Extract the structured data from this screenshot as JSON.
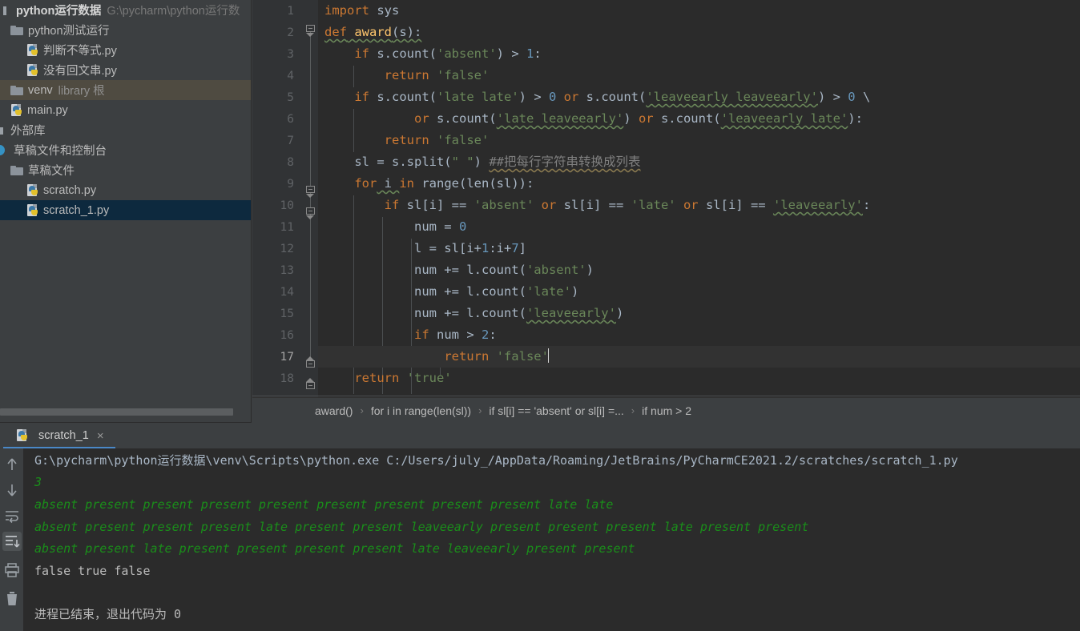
{
  "project": {
    "title": "python运行数据",
    "path": "G:\\pycharm\\python运行数",
    "items": [
      {
        "label": "python运行数据",
        "suffix": "G:\\pycharm\\python运行数",
        "icon": "module-icon",
        "indent": 0,
        "bold": true,
        "selected": false
      },
      {
        "label": "python测试运行",
        "suffix": "",
        "icon": "folder-icon",
        "indent": 1,
        "bold": false,
        "selected": false
      },
      {
        "label": "判断不等式.py",
        "suffix": "",
        "icon": "python-file-icon",
        "indent": 2,
        "bold": false,
        "selected": false
      },
      {
        "label": "没有回文串.py",
        "suffix": "",
        "icon": "python-file-icon",
        "indent": 2,
        "bold": false,
        "selected": false
      },
      {
        "label": "venv",
        "suffix": "library 根",
        "icon": "folder-icon",
        "indent": 1,
        "bold": false,
        "selected": false,
        "highlight": true
      },
      {
        "label": "main.py",
        "suffix": "",
        "icon": "python-file-icon",
        "indent": 1,
        "bold": false,
        "selected": false
      },
      {
        "label": "外部库",
        "suffix": "",
        "icon": "external-libraries-icon",
        "indent": 0,
        "bold": false,
        "selected": false
      },
      {
        "label": "草稿文件和控制台",
        "suffix": "",
        "icon": "scratches-icon",
        "indent": 0,
        "bold": false,
        "selected": false
      },
      {
        "label": "草稿文件",
        "suffix": "",
        "icon": "folder-icon",
        "indent": 1,
        "bold": false,
        "selected": false
      },
      {
        "label": "scratch.py",
        "suffix": "",
        "icon": "python-file-icon",
        "indent": 2,
        "bold": false,
        "selected": false
      },
      {
        "label": "scratch_1.py",
        "suffix": "",
        "icon": "python-file-icon",
        "indent": 2,
        "bold": false,
        "selected": true
      }
    ]
  },
  "editor": {
    "lines": [
      {
        "n": "1",
        "current": false
      },
      {
        "n": "2",
        "current": false
      },
      {
        "n": "3",
        "current": false
      },
      {
        "n": "4",
        "current": false
      },
      {
        "n": "5",
        "current": false
      },
      {
        "n": "6",
        "current": false
      },
      {
        "n": "7",
        "current": false
      },
      {
        "n": "8",
        "current": false
      },
      {
        "n": "9",
        "current": false
      },
      {
        "n": "10",
        "current": false
      },
      {
        "n": "11",
        "current": false
      },
      {
        "n": "12",
        "current": false
      },
      {
        "n": "13",
        "current": false
      },
      {
        "n": "14",
        "current": false
      },
      {
        "n": "15",
        "current": false
      },
      {
        "n": "16",
        "current": false
      },
      {
        "n": "17",
        "current": true
      },
      {
        "n": "18",
        "current": false
      }
    ],
    "code": {
      "l1_import": "import",
      "l1_sys": " sys",
      "l2_def": "def",
      "l2_name": " award",
      "l2_rest": "(s):",
      "l3_a": "    ",
      "l3_if": "if",
      "l3_b": " s.count(",
      "l3_str": "'absent'",
      "l3_c": ") > ",
      "l3_num": "1",
      "l3_d": ":",
      "l4_a": "        ",
      "l4_ret": "return",
      "l4_str": " 'false'",
      "l5_a": "    ",
      "l5_if": "if",
      "l5_b": " s.count(",
      "l5_s1": "'late late'",
      "l5_c": ") > ",
      "l5_n": "0",
      "l5_or": " or",
      "l5_d": " s.count(",
      "l5_s2": "'leaveearly leaveearly'",
      "l5_e": ") > ",
      "l5_n2": "0",
      "l5_f": " \\",
      "l6_a": "            ",
      "l6_or": "or",
      "l6_b": " s.count(",
      "l6_s1": "'late leaveearly'",
      "l6_c": ")",
      "l6_or2": " or",
      "l6_d": " s.count(",
      "l6_s2": "'leaveearly late'",
      "l6_e": "):",
      "l7_a": "        ",
      "l7_ret": "return",
      "l7_str": " 'false'",
      "l8_a": "    sl = s.split(",
      "l8_str": "\" \"",
      "l8_b": ") ",
      "l8_cmt": "##把每行字符串转换成列表",
      "l9_a": "    ",
      "l9_for": "for",
      "l9_i": " i ",
      "l9_in": "in",
      "l9_rest": " range(len(sl)):",
      "l10_a": "        ",
      "l10_if": "if",
      "l10_b": " sl[i] == ",
      "l10_s1": "'absent'",
      "l10_or": " or",
      "l10_c": " sl[i] == ",
      "l10_s2": "'late'",
      "l10_or2": " or",
      "l10_d": " sl[i] == ",
      "l10_s3": "'leaveearly'",
      "l10_e": ":",
      "l11_a": "            num = ",
      "l11_n": "0",
      "l12_a": "            l = sl[i+",
      "l12_n1": "1",
      "l12_b": ":i+",
      "l12_n2": "7",
      "l12_c": "]",
      "l13_a": "            num += l.count(",
      "l13_s": "'absent'",
      "l13_b": ")",
      "l14_a": "            num += l.count(",
      "l14_s": "'late'",
      "l14_b": ")",
      "l15_a": "            num += l.count(",
      "l15_s": "'leaveearly'",
      "l15_b": ")",
      "l16_a": "            ",
      "l16_if": "if",
      "l16_b": " num > ",
      "l16_n": "2",
      "l16_c": ":",
      "l17_a": "                ",
      "l17_ret": "return",
      "l17_str": " 'false'",
      "l18_a": "    ",
      "l18_ret": "return",
      "l18_str": " 'true'"
    },
    "breadcrumbs": [
      "award()",
      "for i in range(len(sl))",
      "if sl[i] == 'absent' or sl[i] =...",
      "if num > 2"
    ],
    "breadcrumb_separator": "›"
  },
  "console": {
    "tab_label": "scratch_1",
    "tab_close": "×",
    "toolbar": [
      {
        "name": "scroll-up-icon",
        "active": false
      },
      {
        "name": "scroll-down-icon",
        "active": false
      },
      {
        "name": "soft-wrap-icon",
        "active": false
      },
      {
        "name": "scroll-to-end-icon",
        "active": true
      },
      {
        "name": "print-icon",
        "active": false
      },
      {
        "name": "clear-all-icon",
        "active": false
      }
    ],
    "output": [
      {
        "text": "G:\\pycharm\\python运行数据\\venv\\Scripts\\python.exe C:/Users/july_/AppData/Roaming/JetBrains/PyCharmCE2021.2/scratches/scratch_1.py",
        "style": "cmd"
      },
      {
        "text": "3",
        "style": "green"
      },
      {
        "text": "absent present present present present present present present present late late",
        "style": "green"
      },
      {
        "text": "absent present present present late present present leaveearly present present present late present present",
        "style": "green"
      },
      {
        "text": "absent present late present present present present late leaveearly present present",
        "style": "green"
      },
      {
        "text": "false true false",
        "style": "white"
      },
      {
        "text": "",
        "style": "white"
      },
      {
        "text": "进程已结束，退出代码为 0",
        "style": "white"
      }
    ]
  },
  "colors": {
    "panel_bg": "#3c3f41",
    "editor_bg": "#2b2b2b",
    "gutter_bg": "#313335",
    "selection_blue": "#0d293e",
    "tab_accent": "#4a88c7",
    "keyword": "#cc7832",
    "string": "#6a8759",
    "number": "#6897bb",
    "function": "#ffc66d",
    "default_text": "#a9b7c6",
    "comment": "#808080",
    "console_green": "#1a8e1a"
  }
}
